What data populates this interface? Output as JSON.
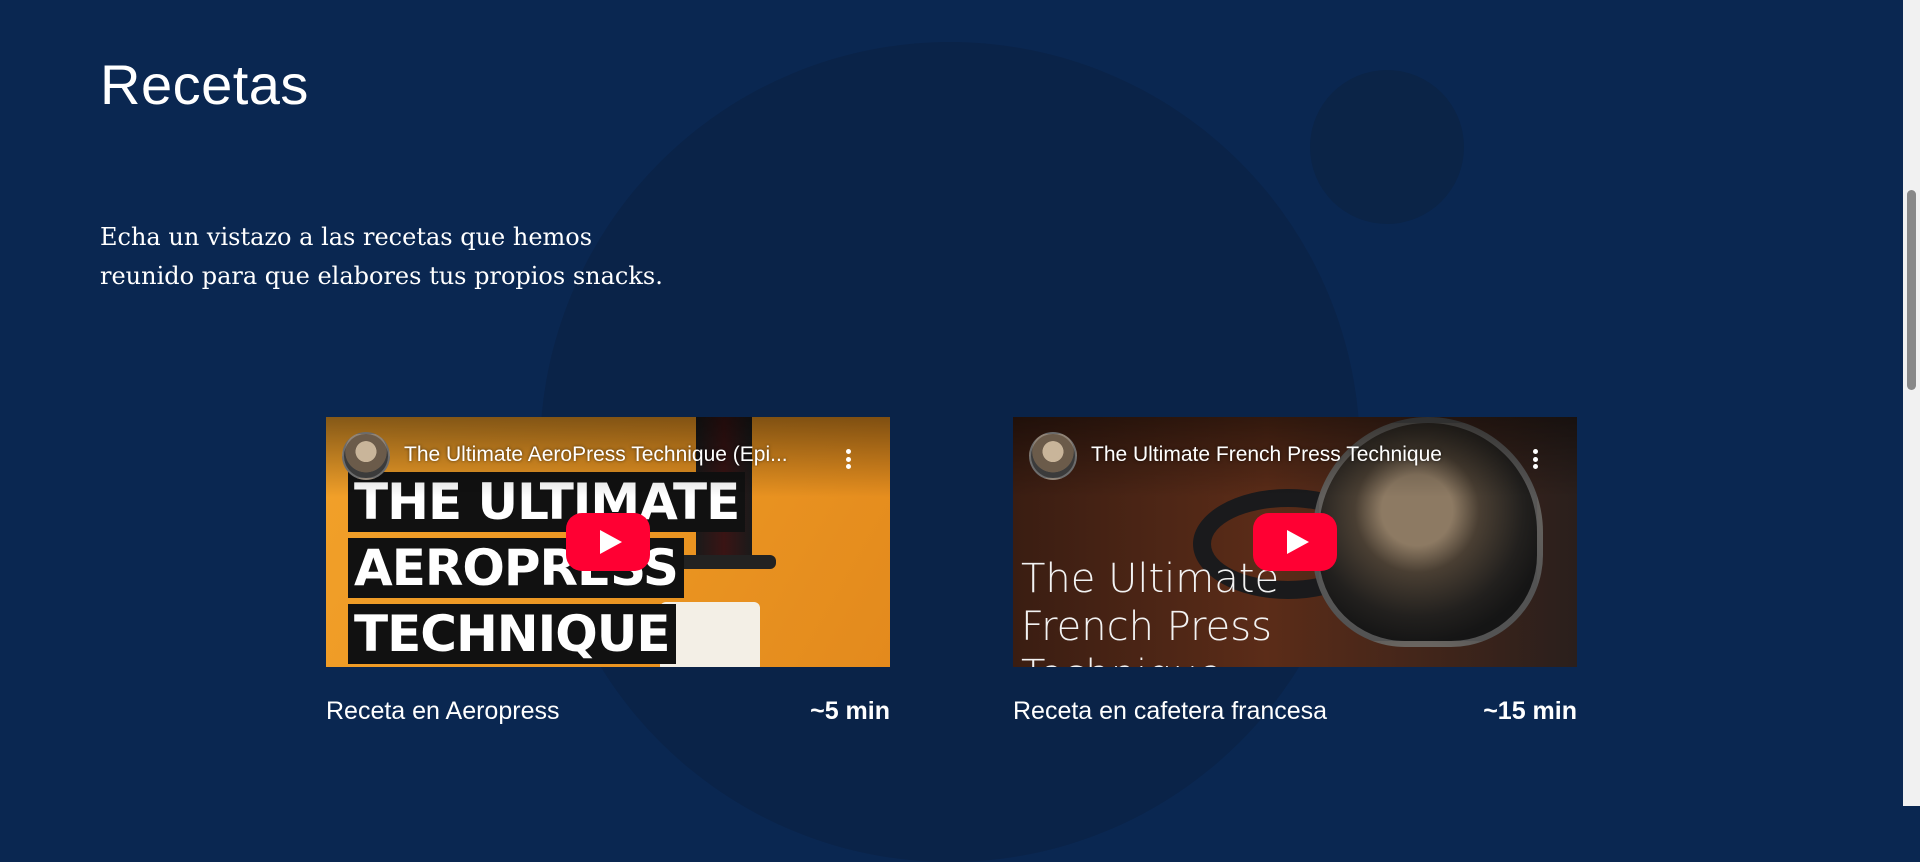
{
  "section": {
    "title": "Recetas",
    "intro_line1": "Echa un vistazo a las recetas que hemos",
    "intro_line2": "reunido para que elabores tus propios snacks."
  },
  "cards": [
    {
      "video_title": "The Ultimate AeroPress Technique (Epi...",
      "thumbnail_text": [
        "THE ULTIMATE",
        "AEROPRESS",
        "TECHNIQUE"
      ],
      "name": "Receta en Aeropress",
      "time": "~5 min"
    },
    {
      "video_title": "The Ultimate French Press Technique",
      "thumbnail_text": [
        "The Ultimate",
        "French Press",
        "Technique"
      ],
      "name": "Receta en cafetera francesa",
      "time": "~15 min"
    }
  ],
  "icons": {
    "play": "youtube-play-icon",
    "menu": "more-vertical-icon"
  },
  "colors": {
    "background": "#0a2751",
    "play_button": "#ff0033"
  }
}
